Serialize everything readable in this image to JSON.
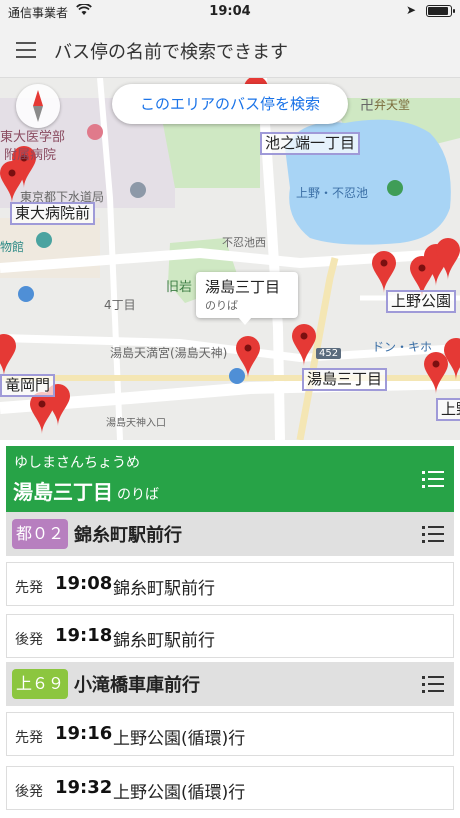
{
  "status": {
    "carrier": "通信事業者",
    "time": "19:04",
    "battery_level": 0.95
  },
  "app_bar": {
    "title": "バス停の名前で検索できます"
  },
  "map": {
    "search_button": "このエリアのバス停を検索",
    "stop_labels": [
      "池之端一丁目",
      "東大病院前",
      "上野公園",
      "湯島三丁目",
      "竜岡門",
      "上野"
    ],
    "poi": {
      "university": "東大医学部",
      "hospital": "附属病院",
      "local_office": "東京都下水道局",
      "museum": "物館",
      "shinobazu": "上野・不忍池",
      "bentendo": "弁天堂",
      "shinobazu_west": "不忍池西",
      "kyu_iwasaki": "旧岩",
      "yonchome": "4丁目",
      "yushima_tenmangu": "湯島天満宮(湯島天神)",
      "yushima_tenjin_iriguchi": "湯島天神入口",
      "donki": "ドン・キホ",
      "route_452": "452"
    },
    "callout": {
      "title": "湯島三丁目",
      "subtitle": "のりば"
    }
  },
  "stop": {
    "kana": "ゆしまさんちょうめ",
    "name": "湯島三丁目",
    "suffix": "のりば"
  },
  "routes": [
    {
      "badge": "都０２",
      "badge_color": "#b77fbf",
      "destination": "錦糸町駅前行",
      "departures": [
        {
          "label": "先発",
          "time": "19:08",
          "dest": "錦糸町駅前行"
        },
        {
          "label": "後発",
          "time": "19:18",
          "dest": "錦糸町駅前行"
        }
      ]
    },
    {
      "badge": "上６９",
      "badge_color": "#8cc63f",
      "destination": "小滝橋車庫前行",
      "departures": [
        {
          "label": "先発",
          "time": "19:16",
          "dest": "上野公園(循環)行"
        },
        {
          "label": "後発",
          "time": "19:32",
          "dest": "上野公園(循環)行"
        }
      ]
    }
  ],
  "colors": {
    "accent_green": "#27a347",
    "link_blue": "#1a73e8",
    "pin_red": "#e53935"
  }
}
